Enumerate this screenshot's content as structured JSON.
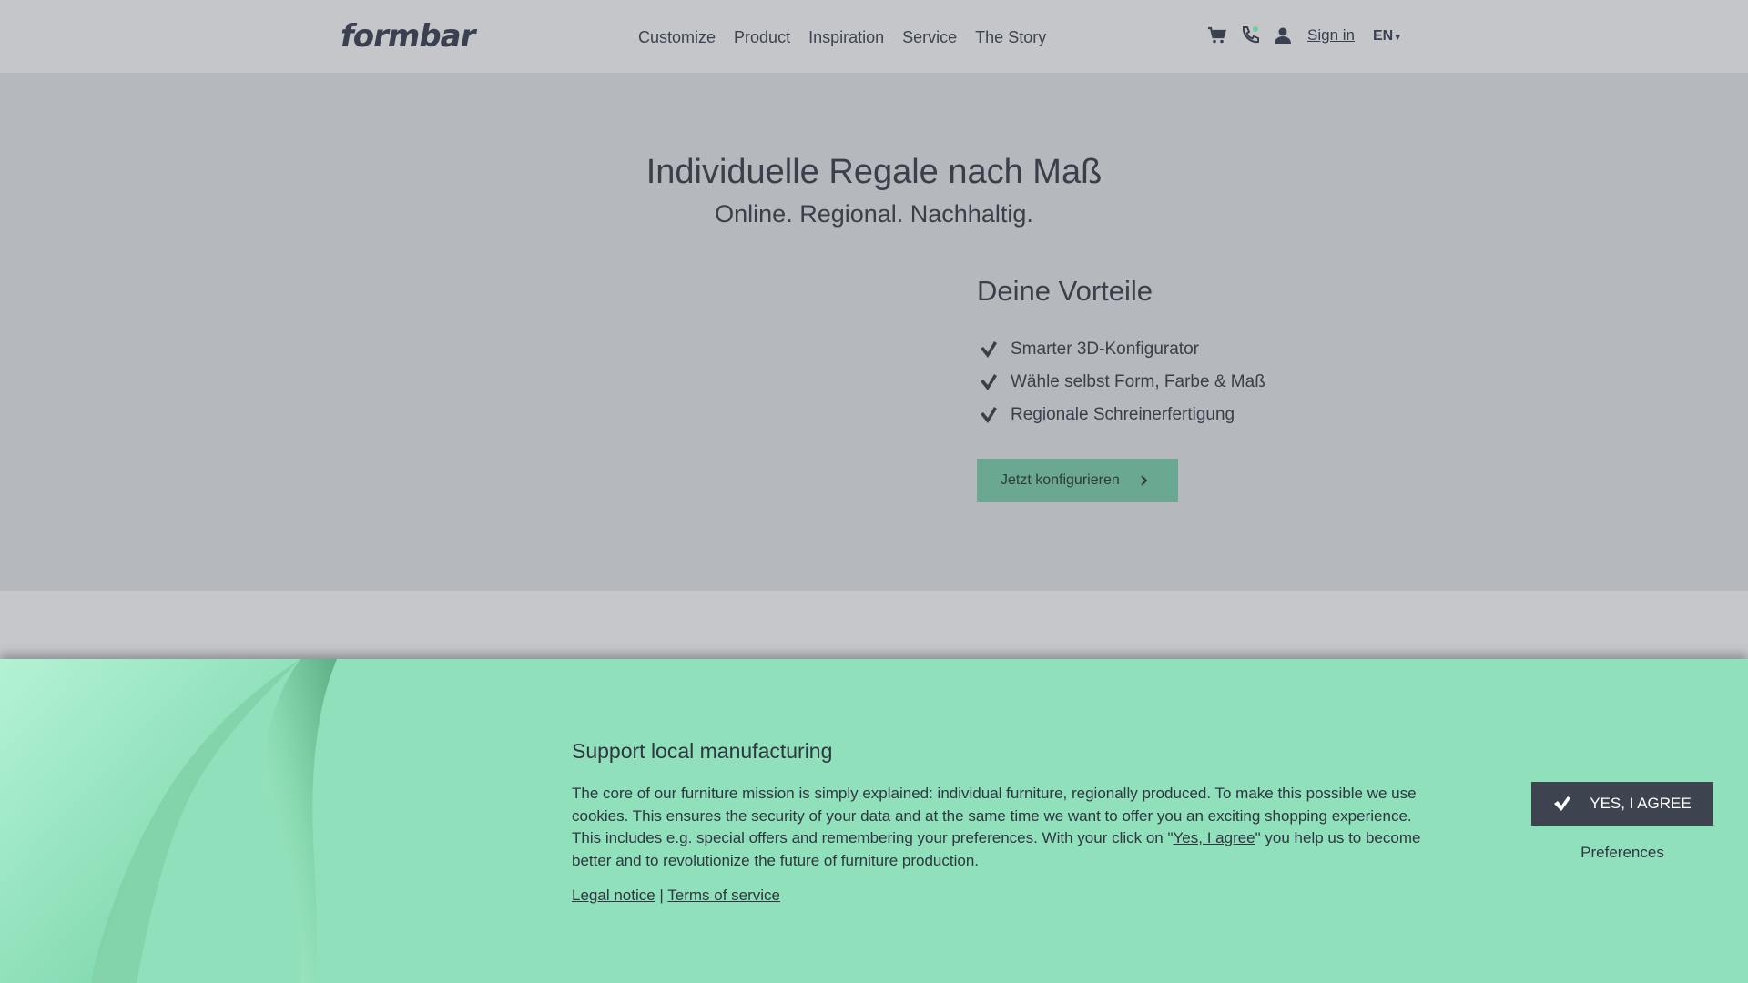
{
  "header": {
    "logo": "formbar",
    "nav": [
      "Customize",
      "Product",
      "Inspiration",
      "Service",
      "The Story"
    ],
    "icons": [
      "cart-icon",
      "phone-icon",
      "user-icon"
    ],
    "signin": "Sign in",
    "lang": "EN"
  },
  "hero": {
    "title": "Individuelle Regale nach Maß",
    "subtitle": "Online. Regional. Nachhaltig.",
    "vorteile_title": "Deine Vorteile",
    "vorteile": [
      "Smarter 3D-Konfigurator",
      "Wähle selbst Form, Farbe & Maß",
      "Regionale Schreinerfertigung"
    ],
    "cta": "Jetzt konfigurieren"
  },
  "cookie": {
    "title": "Support local manufacturing",
    "text_before": "The core of our furniture mission is simply explained: individual furniture, regionally produced. To make this possible we use cookies. This ensures the security of your data and at the same time we want to offer you an exciting shopping experience. This includes e.g. special offers and remembering your preferences. With your click on \"",
    "text_link": "Yes, I agree",
    "text_after": "\" you help us to become better and to revolutionize the future of furniture production.",
    "legal_notice": "Legal notice",
    "separator": "|",
    "terms": "Terms of service",
    "agree_button": "YES, I AGREE",
    "preferences": "Preferences"
  },
  "colors": {
    "header_bg": "#c4c6ca",
    "hero_bg": "#b5b8bd",
    "cta_bg": "#6ba891",
    "cookie_bg": "#8fe0bb",
    "agree_bg": "#3d4450",
    "text": "#3a3f48"
  }
}
